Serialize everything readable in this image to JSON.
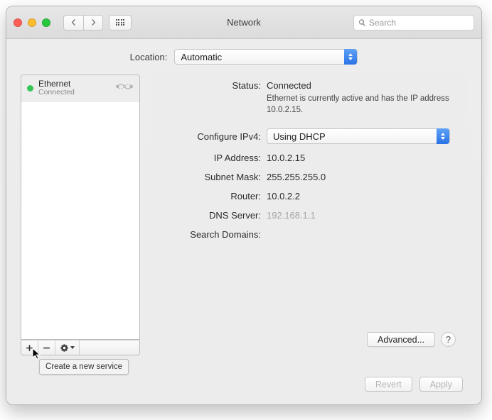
{
  "window": {
    "title": "Network"
  },
  "toolbar": {
    "search_placeholder": "Search"
  },
  "location": {
    "label": "Location:",
    "value": "Automatic"
  },
  "sidebar": {
    "services": [
      {
        "name": "Ethernet",
        "status": "Connected",
        "dot_color": "#37c559"
      }
    ],
    "tooltip": "Create a new service"
  },
  "detail": {
    "status_label": "Status:",
    "status_value": "Connected",
    "status_desc": "Ethernet is currently active and has the IP address 10.0.2.15.",
    "configure_label": "Configure IPv4:",
    "configure_value": "Using DHCP",
    "ip_label": "IP Address:",
    "ip_value": "10.0.2.15",
    "subnet_label": "Subnet Mask:",
    "subnet_value": "255.255.255.0",
    "router_label": "Router:",
    "router_value": "10.0.2.2",
    "dns_label": "DNS Server:",
    "dns_value": "192.168.1.1",
    "search_domains_label": "Search Domains:",
    "search_domains_value": "",
    "advanced": "Advanced...",
    "help": "?"
  },
  "actions": {
    "revert": "Revert",
    "apply": "Apply"
  }
}
